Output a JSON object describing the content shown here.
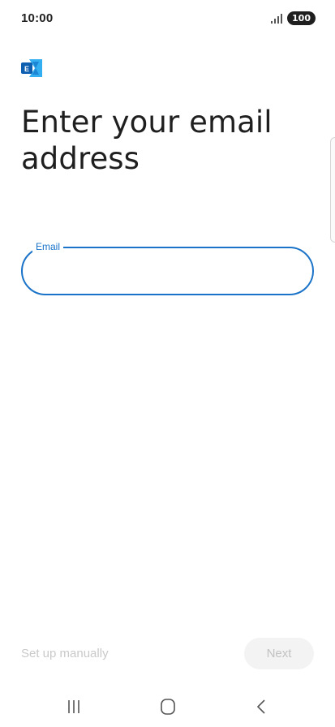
{
  "status_bar": {
    "time": "10:00",
    "signal_icon": "signal-bars-icon",
    "battery": "100"
  },
  "app": {
    "logo_icon": "exchange-logo-icon",
    "logo_letter": "E",
    "brand_colors": {
      "dark_blue": "#0f5fb0",
      "light_blue": "#33aef0"
    }
  },
  "main": {
    "title": "Enter your email address",
    "email_field": {
      "label": "Email",
      "value": "",
      "accent_color": "#1a73c8"
    }
  },
  "footer": {
    "setup_manually_label": "Set up manually",
    "next_label": "Next"
  },
  "nav_bar": {
    "items": [
      "recents-icon",
      "home-icon",
      "back-icon"
    ]
  }
}
